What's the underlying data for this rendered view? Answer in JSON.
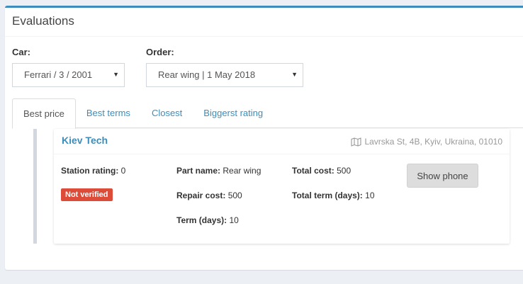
{
  "box": {
    "title": "Evaluations"
  },
  "car": {
    "label": "Car:",
    "selected": "Ferrari / 3 / 2001"
  },
  "order": {
    "label": "Order:",
    "selected": "Rear wing | 1 May 2018"
  },
  "tabs": [
    {
      "label": "Best price",
      "active": true
    },
    {
      "label": "Best terms",
      "active": false
    },
    {
      "label": "Closest",
      "active": false
    },
    {
      "label": "Biggerst rating",
      "active": false
    }
  ],
  "station": {
    "name": "Kiev Tech",
    "address": "Lavrska St, 4B, Kyiv, Ukraina, 01010",
    "address_icon": "map-icon",
    "rating_label": "Station rating:",
    "rating_value": "0",
    "status_badge": "Not verified",
    "part_label": "Part name:",
    "part_value": "Rear wing",
    "repair_label": "Repair cost:",
    "repair_value": "500",
    "term_label": "Term (days):",
    "term_value": "10",
    "total_cost_label": "Total cost:",
    "total_cost_value": "500",
    "total_term_label": "Total term (days):",
    "total_term_value": "10",
    "show_phone_label": "Show phone"
  },
  "colors": {
    "accent": "#3c8dbc",
    "danger": "#dd4b39",
    "background": "#ecf0f5"
  }
}
